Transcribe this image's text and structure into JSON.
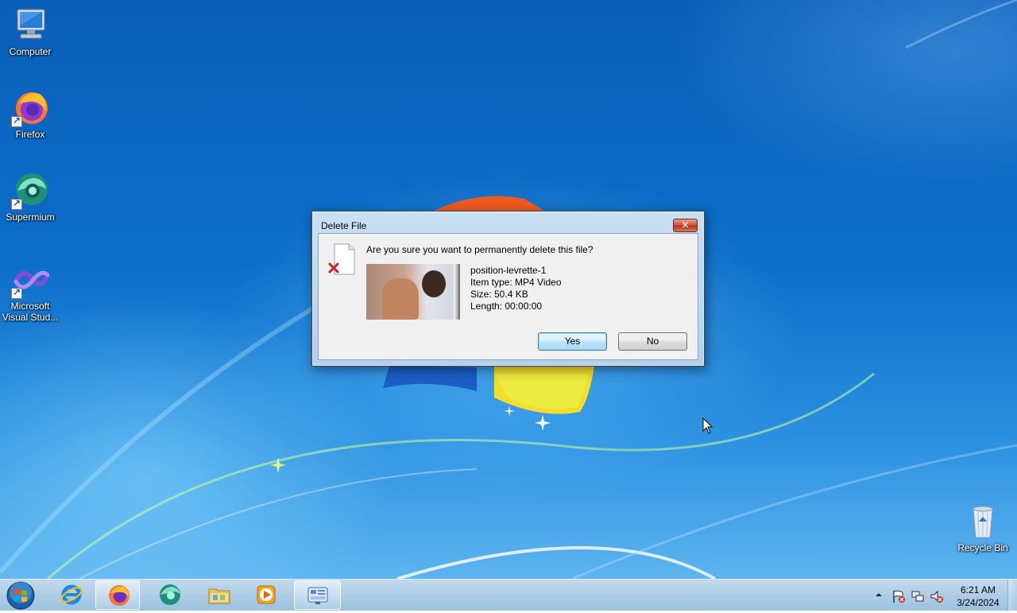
{
  "desktop": {
    "icons": [
      {
        "label": "Computer",
        "icon": "computer-icon"
      },
      {
        "label": "Firefox",
        "icon": "firefox-icon"
      },
      {
        "label": "Supermium",
        "icon": "supermium-icon"
      },
      {
        "label": "Microsoft Visual Stud...",
        "icon": "visual-studio-icon"
      },
      {
        "label": "Recycle Bin",
        "icon": "recycle-bin-icon"
      }
    ]
  },
  "dialog": {
    "title": "Delete File",
    "close_label": "✕",
    "question": "Are you sure you want to permanently delete this file?",
    "file": {
      "name": "position-levrette-1",
      "type": "Item type: MP4 Video",
      "size": "Size: 50.4 KB",
      "length": "Length: 00:00:00"
    },
    "yes_label": "Yes",
    "no_label": "No"
  },
  "taskbar": {
    "items": [
      "start-orb-icon",
      "internet-explorer-icon",
      "firefox-icon",
      "supermium-icon",
      "file-explorer-icon",
      "media-player-icon",
      "control-panel-icon"
    ],
    "active_item": "firefox-icon",
    "clock": {
      "time": "6:21 AM",
      "date": "3/24/2024"
    }
  },
  "colors": {
    "accent": "#1a5ab8",
    "wallpaper": "#0c6dc9",
    "close_button": "#c8432b"
  }
}
